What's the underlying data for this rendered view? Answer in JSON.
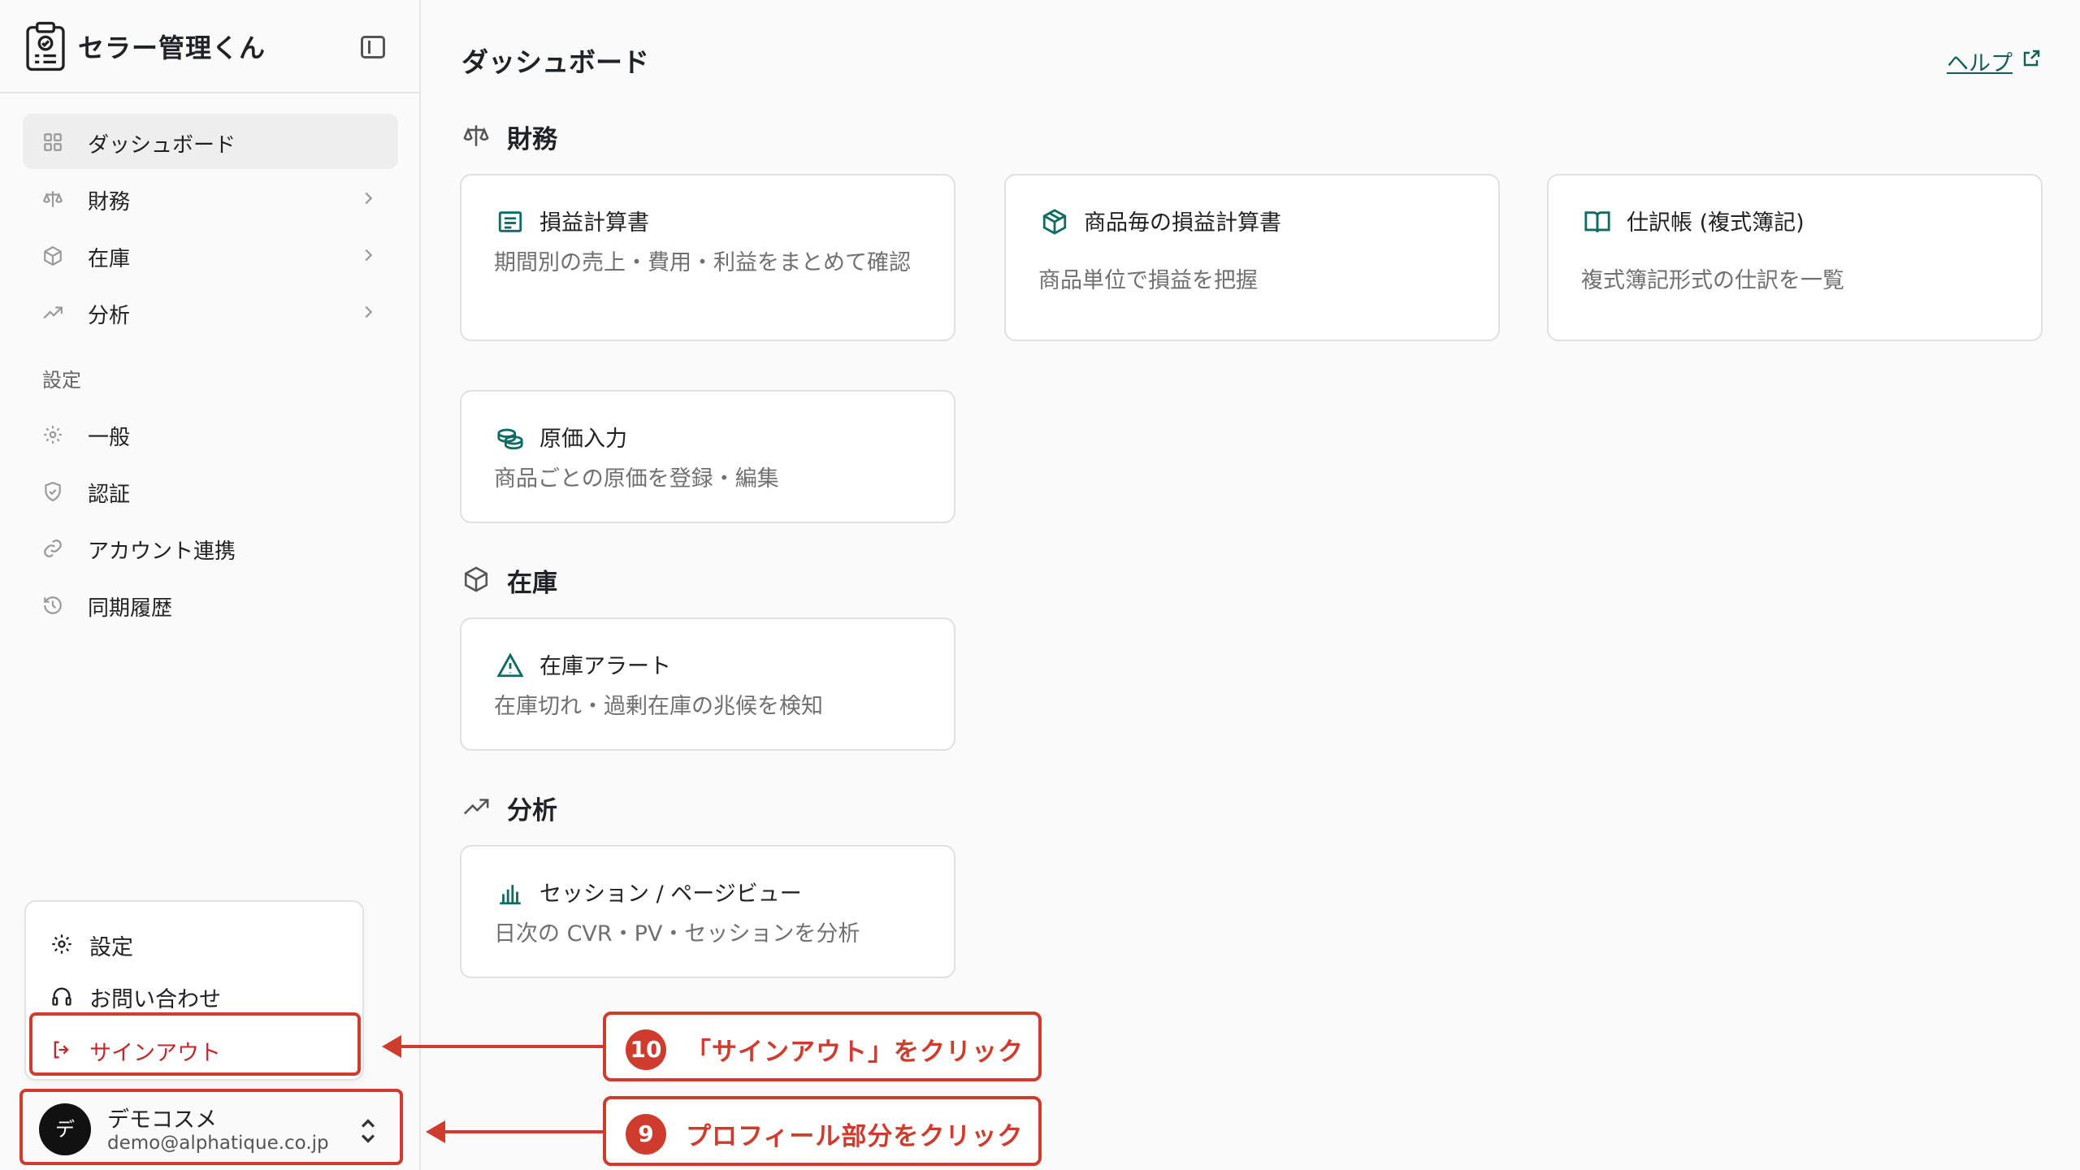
{
  "app": {
    "title": "セラー管理くん"
  },
  "sidebar": {
    "items": [
      {
        "label": "ダッシュボード"
      },
      {
        "label": "財務"
      },
      {
        "label": "在庫"
      },
      {
        "label": "分析"
      }
    ],
    "settings_section": "設定",
    "settings_items": [
      {
        "label": "一般"
      },
      {
        "label": "認証"
      },
      {
        "label": "アカウント連携"
      },
      {
        "label": "同期履歴"
      }
    ]
  },
  "menu": {
    "settings": "設定",
    "contact": "お問い合わせ",
    "signout": "サインアウト"
  },
  "profile": {
    "avatar_initial": "デ",
    "name": "デモコスメ",
    "email": "demo@alphatique.co.jp"
  },
  "main": {
    "title": "ダッシュボード",
    "help": "ヘルプ",
    "sections": {
      "finance": {
        "title": "財務",
        "cards": [
          {
            "title": "損益計算書",
            "desc": "期間別の売上・費用・利益をまとめて確認"
          },
          {
            "title": "商品毎の損益計算書",
            "desc": "商品単位で損益を把握"
          },
          {
            "title": "仕訳帳 (複式簿記)",
            "desc": "複式簿記形式の仕訳を一覧"
          },
          {
            "title": "原価入力",
            "desc": "商品ごとの原価を登録・編集"
          }
        ]
      },
      "inventory": {
        "title": "在庫",
        "cards": [
          {
            "title": "在庫アラート",
            "desc": "在庫切れ・過剰在庫の兆候を検知"
          }
        ]
      },
      "analysis": {
        "title": "分析",
        "cards": [
          {
            "title": "セッション / ページビュー",
            "desc": "日次の CVR・PV・セッションを分析"
          }
        ]
      }
    }
  },
  "annotations": [
    {
      "number": "10",
      "text": "「サインアウト」をクリック"
    },
    {
      "number": "9",
      "text": "プロフィール部分をクリック"
    }
  ],
  "colors": {
    "accent": "#0f6b64",
    "annotation": "#cf3b2c",
    "signout": "#c62828"
  }
}
